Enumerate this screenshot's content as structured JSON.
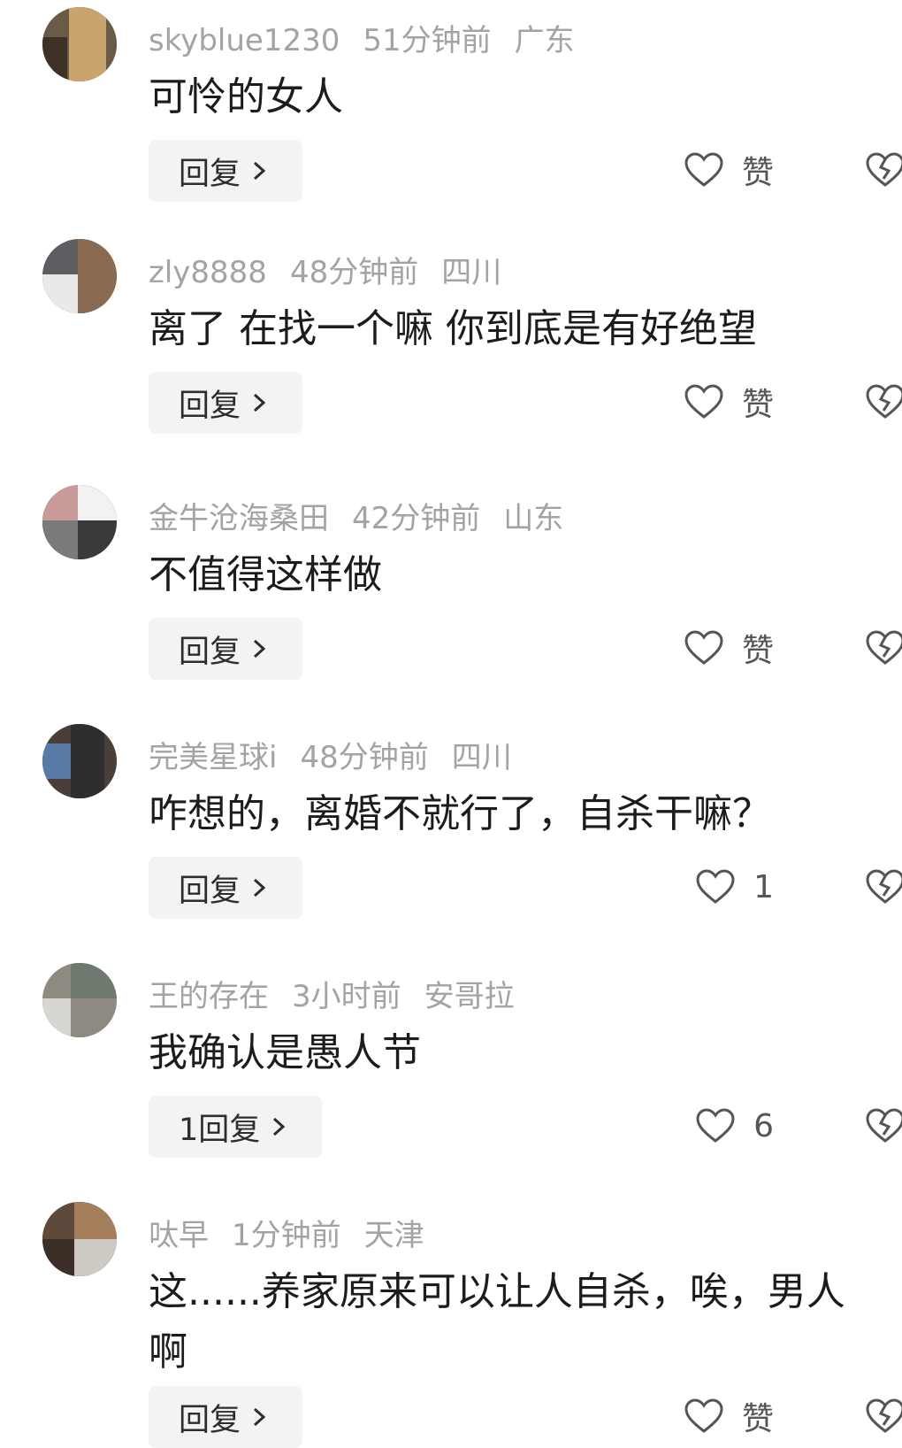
{
  "comments": [
    {
      "username": "skyblue1230",
      "time": "51分钟前",
      "location": "广东",
      "text": "可怜的女人",
      "reply_label": "回复",
      "like_label": "赞"
    },
    {
      "username": "zly8888",
      "time": "48分钟前",
      "location": "四川",
      "text": "离了 在找一个嘛 你到底是有好绝望",
      "reply_label": "回复",
      "like_label": "赞"
    },
    {
      "username": "金牛沧海桑田",
      "time": "42分钟前",
      "location": "山东",
      "text": "不值得这样做",
      "reply_label": "回复",
      "like_label": "赞"
    },
    {
      "username": "完美星球i",
      "time": "48分钟前",
      "location": "四川",
      "text": "咋想的，离婚不就行了，自杀干嘛？",
      "reply_label": "回复",
      "like_label": "1"
    },
    {
      "username": "王的存在",
      "time": "3小时前",
      "location": "安哥拉",
      "text": "我确认是愚人节",
      "reply_label": "1回复",
      "like_label": "6"
    },
    {
      "username": "呔早",
      "time": "1分钟前",
      "location": "天津",
      "text": "这......养家原来可以让人自杀，唉，男人啊",
      "reply_label": "回复",
      "like_label": "赞"
    }
  ],
  "icons": {
    "like": "heart-outline-icon",
    "dislike": "broken-heart-icon",
    "reply_arrow": "chevron-right-icon"
  },
  "colors": {
    "meta_text": "#a3a3a3",
    "body_text": "#1c1c1c",
    "reply_bg": "#f3f3f3",
    "icon_stroke": "#555555"
  }
}
